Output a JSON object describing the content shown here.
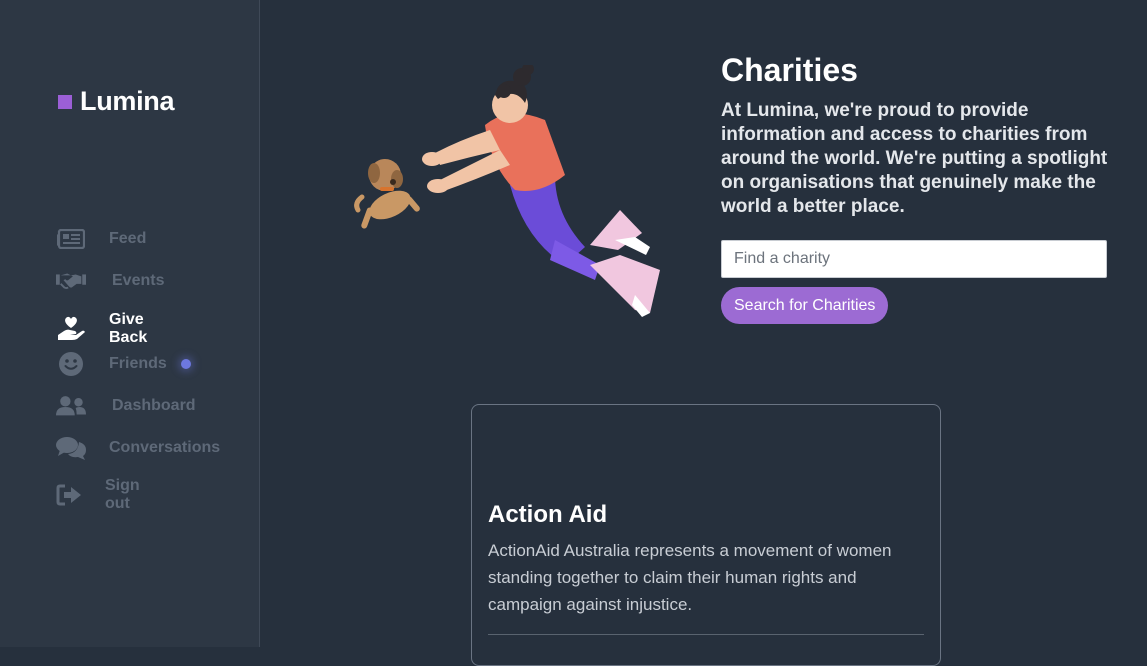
{
  "app": {
    "name": "Lumina",
    "accent": "#9b5fd6"
  },
  "sidebar": {
    "items": [
      {
        "label": "Feed",
        "icon": "newspaper-icon",
        "active": false
      },
      {
        "label": "Events",
        "icon": "handshake-icon",
        "active": false
      },
      {
        "label": "Give Back",
        "icon": "heart-hand-icon",
        "active": true
      },
      {
        "label": "Friends",
        "icon": "smile-icon",
        "active": false,
        "notification": true
      },
      {
        "label": "Dashboard",
        "icon": "users-icon",
        "active": false
      },
      {
        "label": "Conversations",
        "icon": "comments-icon",
        "active": false
      },
      {
        "label": "Sign out",
        "icon": "sign-out-icon",
        "active": false
      }
    ]
  },
  "hero": {
    "title": "Charities",
    "description": "At Lumina, we're proud to provide information and access to charities from around the world. We're putting a spotlight on organisations that genuinely make the world a better place.",
    "search_placeholder": "Find a charity",
    "search_button": "Search for Charities"
  },
  "charities": [
    {
      "name": "Action Aid",
      "description": "ActionAid Australia represents a movement of women standing together to claim their human rights and campaign against injustice."
    }
  ]
}
